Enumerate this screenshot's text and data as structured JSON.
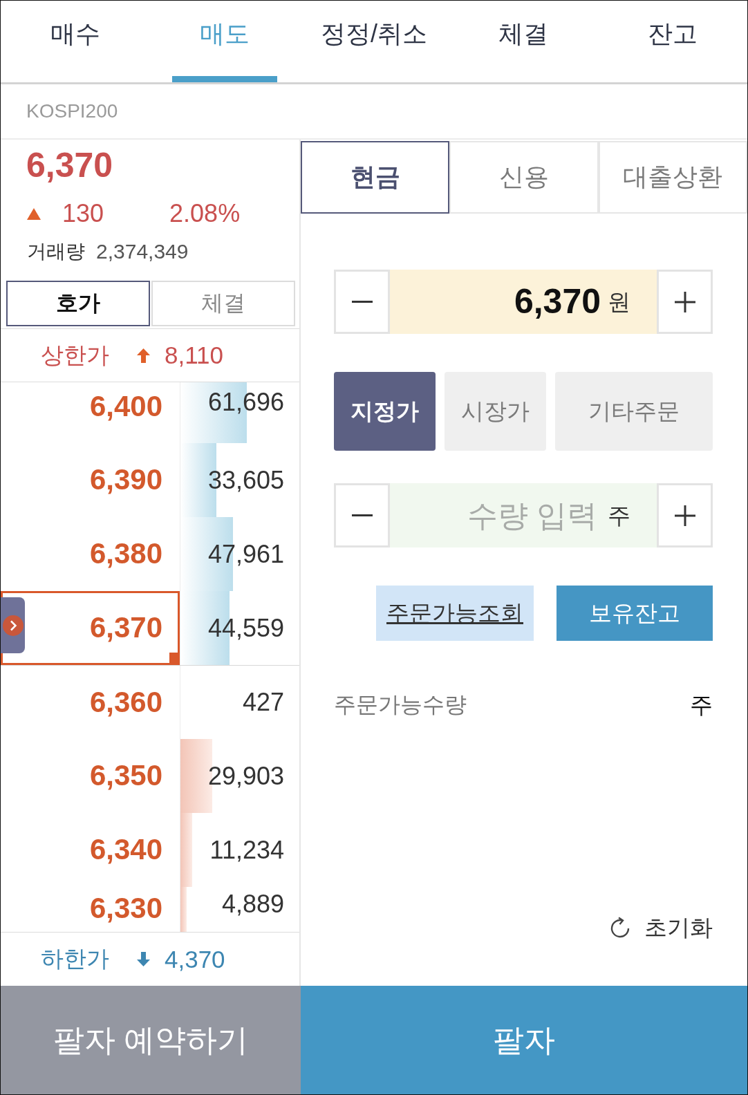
{
  "top_tabs": [
    {
      "label": "매수",
      "selected": false
    },
    {
      "label": "매도",
      "selected": true
    },
    {
      "label": "정정/취소",
      "selected": false
    },
    {
      "label": "체결",
      "selected": false
    },
    {
      "label": "잔고",
      "selected": false
    }
  ],
  "instrument": {
    "name": "KOSPI200"
  },
  "quote": {
    "price": "6,370",
    "change": "130",
    "change_rate": "2.08%",
    "volume_label": "거래량",
    "volume": "2,374,349"
  },
  "book_tabs": [
    {
      "label": "호가",
      "selected": true
    },
    {
      "label": "체결",
      "selected": false
    }
  ],
  "upper_limit": {
    "label": "상한가",
    "value": "8,110"
  },
  "order_book": [
    {
      "price": "6,400",
      "quantity": "61,696",
      "kind": "ask",
      "level": 0.56,
      "selected": false
    },
    {
      "price": "6,390",
      "quantity": "33,605",
      "kind": "ask",
      "level": 0.3,
      "selected": false
    },
    {
      "price": "6,380",
      "quantity": "47,961",
      "kind": "ask",
      "level": 0.44,
      "selected": false
    },
    {
      "price": "6,370",
      "quantity": "44,559",
      "kind": "ask",
      "level": 0.41,
      "selected": true
    },
    {
      "price": "6,360",
      "quantity": "427",
      "kind": "bid",
      "selected": false
    },
    {
      "price": "6,350",
      "quantity": "29,903",
      "kind": "bid",
      "level": 0.27,
      "selected": false
    },
    {
      "price": "6,340",
      "quantity": "11,234",
      "kind": "bid",
      "level": 0.1,
      "selected": false
    },
    {
      "price": "6,330",
      "quantity": "4,889",
      "kind": "bid",
      "level": 0.05,
      "selected": false
    }
  ],
  "lower_limit": {
    "label": "하한가",
    "value": "4,370"
  },
  "account_tabs": [
    {
      "label": "현금",
      "selected": true
    },
    {
      "label": "신용",
      "selected": false
    },
    {
      "label": "대출상환",
      "selected": false
    }
  ],
  "price_input": {
    "value": "6,370",
    "unit": "원"
  },
  "order_types": [
    {
      "label": "지정가",
      "selected": true
    },
    {
      "label": "시장가",
      "selected": false
    },
    {
      "label": "기타주문",
      "selected": false
    }
  ],
  "quantity_input": {
    "placeholder": "수량 입력",
    "unit": "주"
  },
  "actions": [
    {
      "label": "주문가능조회",
      "kind": "link"
    },
    {
      "label": "보유잔고",
      "kind": "primary"
    }
  ],
  "available_quantity": {
    "label": "주문가능수량",
    "unit": "주"
  },
  "reset": {
    "label": "초기화"
  },
  "bottom_buttons": [
    {
      "label": "팔자 예약하기",
      "kind": "secondary"
    },
    {
      "label": "팔자",
      "kind": "primary"
    }
  ]
}
